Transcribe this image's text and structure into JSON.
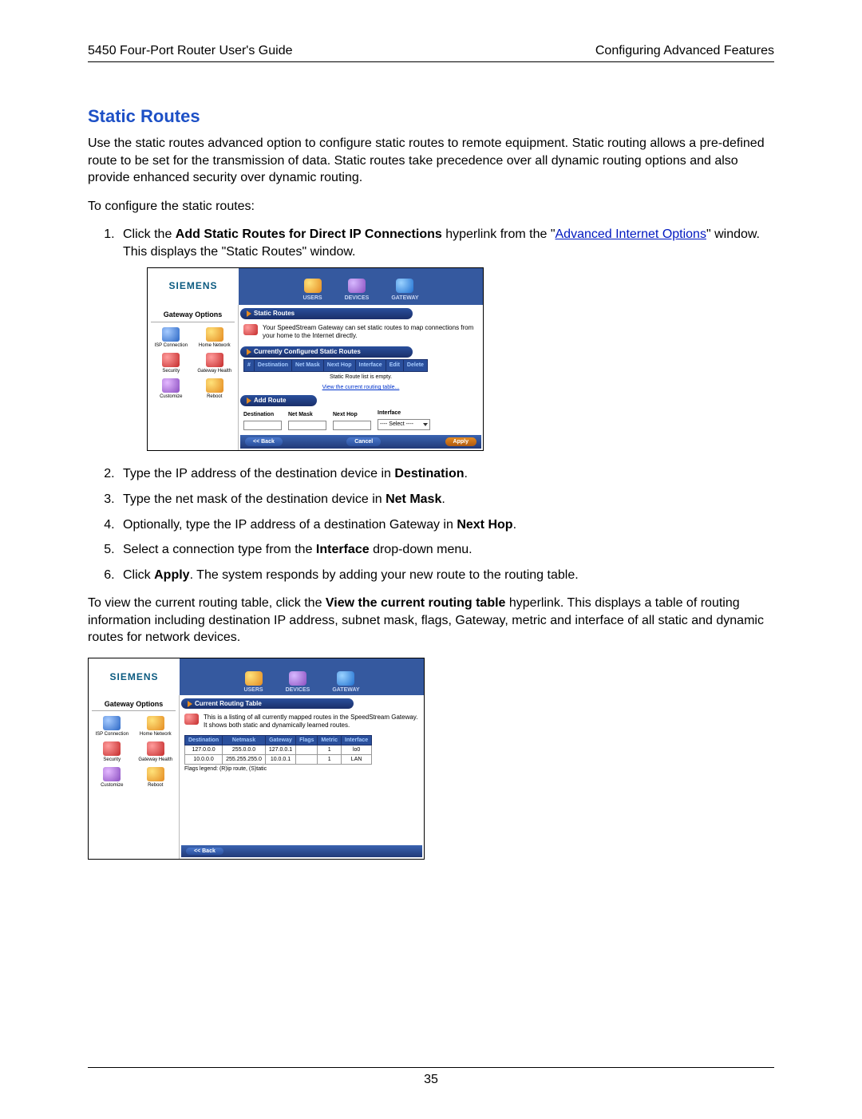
{
  "header": {
    "left": "5450 Four-Port Router User's Guide",
    "right": "Configuring Advanced Features"
  },
  "section_title": "Static Routes",
  "intro_para": "Use the static routes advanced option to configure static routes to remote equipment. Static routing allows a pre-defined route to be set for the transmission of data. Static routes take precedence over all dynamic routing options and also provide enhanced security over dynamic routing.",
  "configure_intro": "To configure the static routes:",
  "steps": {
    "s1_prefix": "Click the ",
    "s1_bold": "Add Static Routes for Direct IP Connections",
    "s1_mid": " hyperlink from the \"",
    "s1_link": "Advanced Internet Options",
    "s1_suffix": "\" window. This displays the \"Static Routes\" window.",
    "s2_prefix": "Type the IP address of the destination device in ",
    "s2_bold": "Destination",
    "s2_suffix": ".",
    "s3_prefix": "Type the net mask of the destination device in ",
    "s3_bold": "Net Mask",
    "s3_suffix": ".",
    "s4_prefix": "Optionally, type the IP address of a destination Gateway in ",
    "s4_bold": "Next Hop",
    "s4_suffix": ".",
    "s5_prefix": "Select a connection type from the ",
    "s5_bold": "Interface",
    "s5_suffix": " drop-down menu.",
    "s6_prefix": "Click ",
    "s6_bold": "Apply",
    "s6_suffix": ". The system responds by adding your new route to the routing table."
  },
  "view_para_prefix": "To view the current routing table, click the ",
  "view_para_bold": "View the current routing table",
  "view_para_suffix": " hyperlink. This displays a table of routing information including destination IP address, subnet mask, flags, Gateway, metric and interface of all static and dynamic routes for network devices.",
  "brand": "SIEMENS",
  "top_nav": {
    "users": "USERS",
    "devices": "DEVICES",
    "gateway": "GATEWAY"
  },
  "sidebar": {
    "title": "Gateway Options",
    "items": {
      "isp": "ISP Connection",
      "home": "Home Network",
      "security": "Security",
      "health": "Gateway Health",
      "customize": "Customize",
      "reboot": "Reboot"
    }
  },
  "screenshot1": {
    "pill1": "Static Routes",
    "desc": "Your SpeedStream Gateway can set static routes to map connections from your home to the Internet directly.",
    "pill2": "Currently Configured Static Routes",
    "cols": {
      "num": "#",
      "dest": "Destination",
      "mask": "Net Mask",
      "hop": "Next Hop",
      "iface": "Interface",
      "edit": "Edit",
      "delete": "Delete"
    },
    "empty": "Static Route list is empty.",
    "view_link": "View the current routing table...",
    "pill3": "Add Route",
    "fields": {
      "dest": "Destination",
      "mask": "Net Mask",
      "hop": "Next Hop",
      "iface": "Interface"
    },
    "select_default": "---- Select ----",
    "buttons": {
      "back": "<< Back",
      "cancel": "Cancel",
      "apply": "Apply"
    }
  },
  "screenshot2": {
    "pill1": "Current Routing Table",
    "desc": "This is a listing of all currently mapped routes in the SpeedStream Gateway. It shows both static and dynamically learned routes.",
    "cols": {
      "dest": "Destination",
      "mask": "Netmask",
      "gateway": "Gateway",
      "flags": "Flags",
      "metric": "Metric",
      "iface": "Interface"
    },
    "rows": [
      {
        "dest": "127.0.0.0",
        "mask": "255.0.0.0",
        "gateway": "127.0.0.1",
        "flags": "",
        "metric": "1",
        "iface": "lo0"
      },
      {
        "dest": "10.0.0.0",
        "mask": "255.255.255.0",
        "gateway": "10.0.0.1",
        "flags": "",
        "metric": "1",
        "iface": "LAN"
      }
    ],
    "legend": "Flags legend: (R)ip route, (S)tatic",
    "buttons": {
      "back": "<< Back"
    }
  },
  "page_number": "35"
}
